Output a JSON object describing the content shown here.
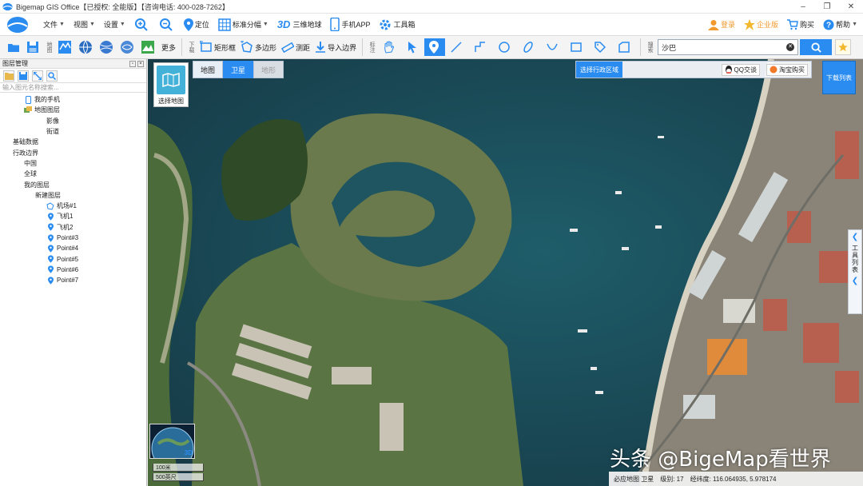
{
  "window": {
    "title": "Bigemap GIS Office【已授权: 全能版】【咨询电话: 400-028-7262】",
    "buttons": [
      "–",
      "❐",
      "✕"
    ]
  },
  "menubar": {
    "items": [
      {
        "label": "文件",
        "caret": true
      },
      {
        "label": "视图",
        "caret": true
      },
      {
        "label": "设置",
        "caret": true
      }
    ],
    "locate": "定位",
    "grid": "标准分幅",
    "threed": "三维地球",
    "mobile_app": "手机APP",
    "toolbox": "工具箱",
    "login": "登录",
    "enterprise": "企业版",
    "buy": "购买",
    "help": "帮助"
  },
  "toolbar": {
    "label_map": "地图",
    "more": "更多",
    "label_download": "下载",
    "rect_frame": "矩形框",
    "polygon": "多边形",
    "measure": "测距",
    "import_boundary": "导入边界",
    "label_annotate": "标注",
    "label_search": "搜索",
    "search_value": "沙巴"
  },
  "layers_panel": {
    "title": "图层管理",
    "search_placeholder": "输入图元名称搜索...",
    "tree": [
      {
        "label": "我的手机",
        "level": 1,
        "icon": "phone-icon"
      },
      {
        "label": "地图图层",
        "level": 1,
        "icon": "layers-icon"
      },
      {
        "label": "影像",
        "level": 3,
        "icon": ""
      },
      {
        "label": "街道",
        "level": 3,
        "icon": ""
      },
      {
        "label": "基础数据",
        "level": 0,
        "icon": ""
      },
      {
        "label": "行政边界",
        "level": 0,
        "icon": ""
      },
      {
        "label": "中国",
        "level": 1,
        "icon": ""
      },
      {
        "label": "全球",
        "level": 1,
        "icon": ""
      },
      {
        "label": "我的图层",
        "level": 1,
        "icon": ""
      },
      {
        "label": "新建图层",
        "level": 2,
        "icon": ""
      },
      {
        "label": "机场#1",
        "level": 3,
        "icon": "polygon-layer-icon"
      },
      {
        "label": "飞机1",
        "level": 3,
        "icon": "pin-icon"
      },
      {
        "label": "飞机2",
        "level": 3,
        "icon": "pin-icon"
      },
      {
        "label": "Point#3",
        "level": 3,
        "icon": "pin-icon"
      },
      {
        "label": "Point#4",
        "level": 3,
        "icon": "pin-icon"
      },
      {
        "label": "Point#5",
        "level": 3,
        "icon": "pin-icon"
      },
      {
        "label": "Point#6",
        "level": 3,
        "icon": "pin-icon"
      },
      {
        "label": "Point#7",
        "level": 3,
        "icon": "pin-icon"
      }
    ]
  },
  "map": {
    "select_map": "选择地图",
    "tabs": [
      {
        "label": "地图",
        "state": "normal"
      },
      {
        "label": "卫星",
        "state": "active"
      },
      {
        "label": "地形",
        "state": "disabled"
      }
    ],
    "region_select": "选择行政区域",
    "qq_chat": "QQ交谈",
    "taobao_buy": "淘宝购买",
    "download_list": "下载列表",
    "side_tools": "工具列表",
    "minimap_badge": "3D",
    "scale_top": "100米",
    "scale_bottom": "500英尺",
    "status": {
      "source": "必应地图 卫星",
      "level": "级别: 17",
      "coords": "经纬度: 116.064935, 5.978174"
    },
    "watermark": "头条 @BigeMap看世界"
  },
  "colors": {
    "accent": "#2a8cf0",
    "water": "#1d4a57",
    "vegetation": "#4d6e3a"
  }
}
